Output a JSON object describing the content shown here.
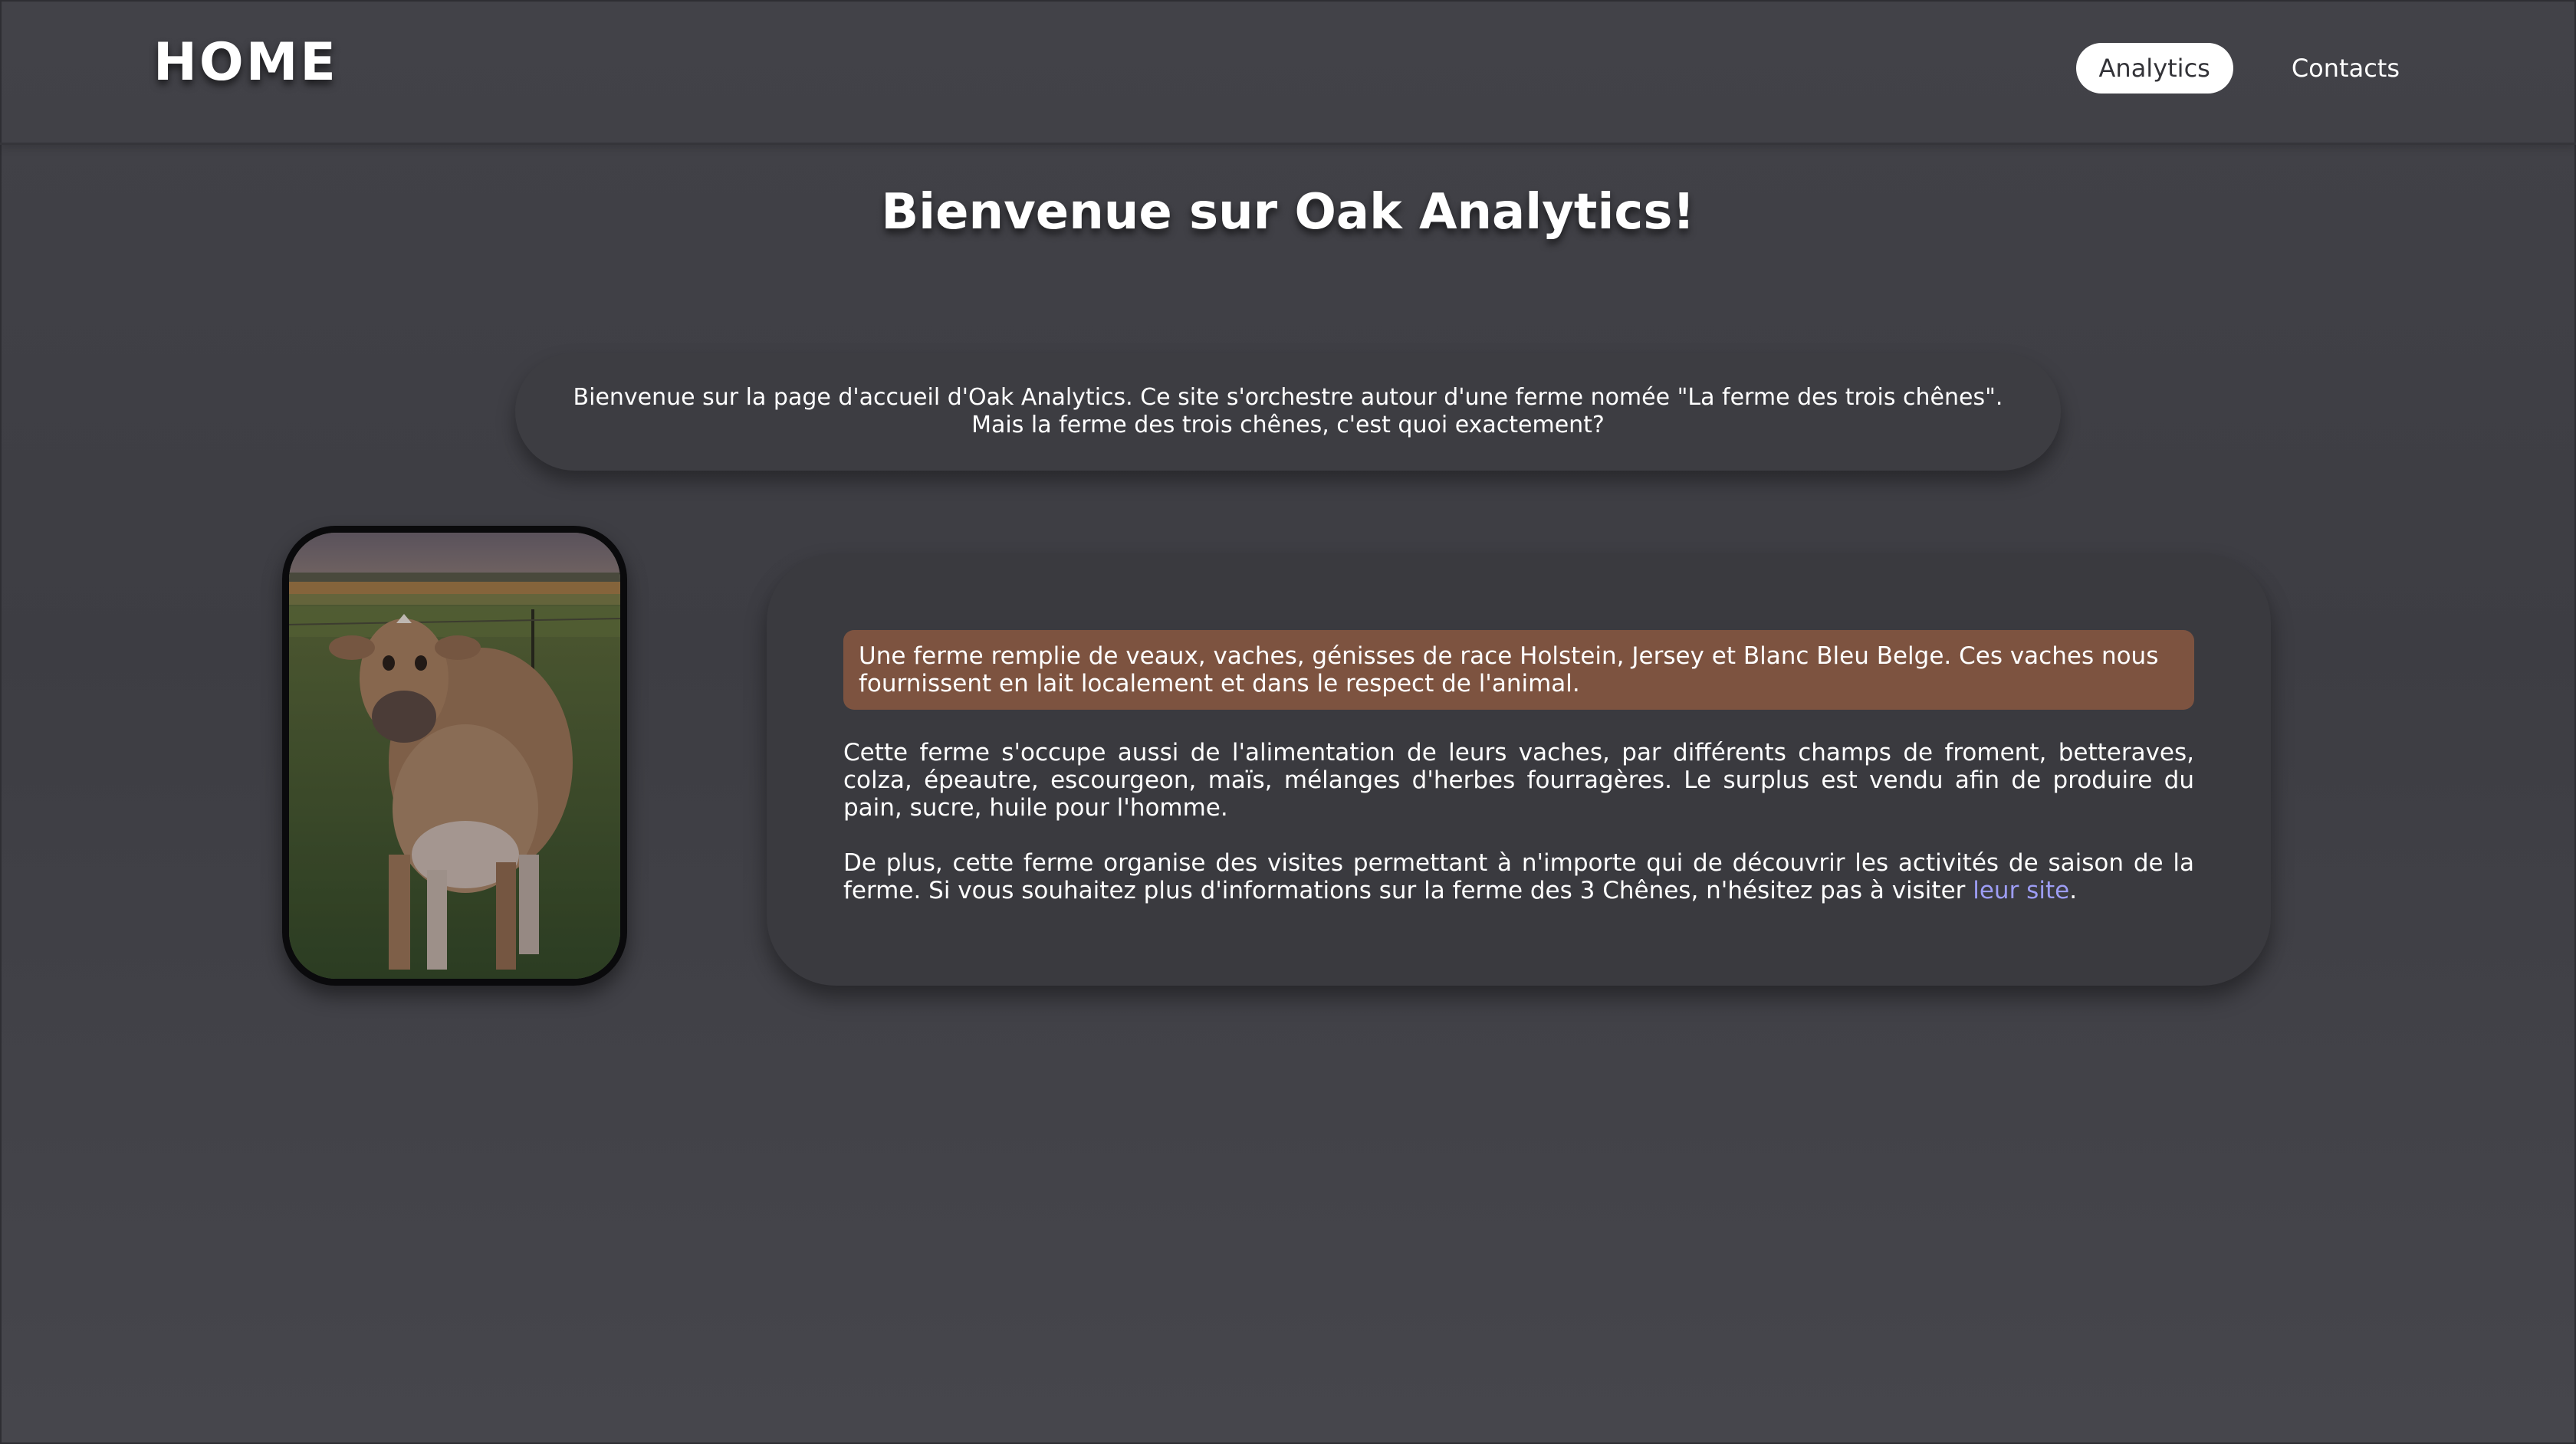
{
  "header": {
    "brand": "HOME",
    "nav": [
      {
        "label": "Analytics",
        "active": true
      },
      {
        "label": "Contacts",
        "active": false
      }
    ]
  },
  "main": {
    "title": "Bienvenue sur Oak Analytics!",
    "intro": "Bienvenue sur la page d'accueil d'Oak Analytics. Ce site s'orchestre autour d'une ferme nomée \"La ferme des trois chênes\". Mais la ferme des trois chênes, c'est quoi exactement?",
    "highlight": "Une ferme remplie de veaux, vaches, génisses de race Holstein, Jersey et Blanc Bleu Belge. Ces vaches nous fournissent en lait localement et dans le respect de l'animal.",
    "paragraph1": "Cette ferme s'occupe aussi de l'alimentation de leurs vaches, par différents champs de froment, betteraves, colza, épeautre, escourgeon, maïs, mélanges d'herbes fourragères. Le surplus est vendu afin de produire du pain, sucre, huile pour l'homme.",
    "paragraph2": "De plus, cette ferme organise des visites permettant à n'importe qui de découvrir les activités de saison de la ferme. Si vous souhaitez plus d'informations sur la ferme des 3 Chênes, n'hésitez pas à visiter",
    "link_label": "leur site",
    "link_suffix": "."
  },
  "colors": {
    "background": "#3f3f45",
    "highlight": "#7d5340",
    "link": "#9d9df5",
    "active_nav": "#ffffff"
  }
}
